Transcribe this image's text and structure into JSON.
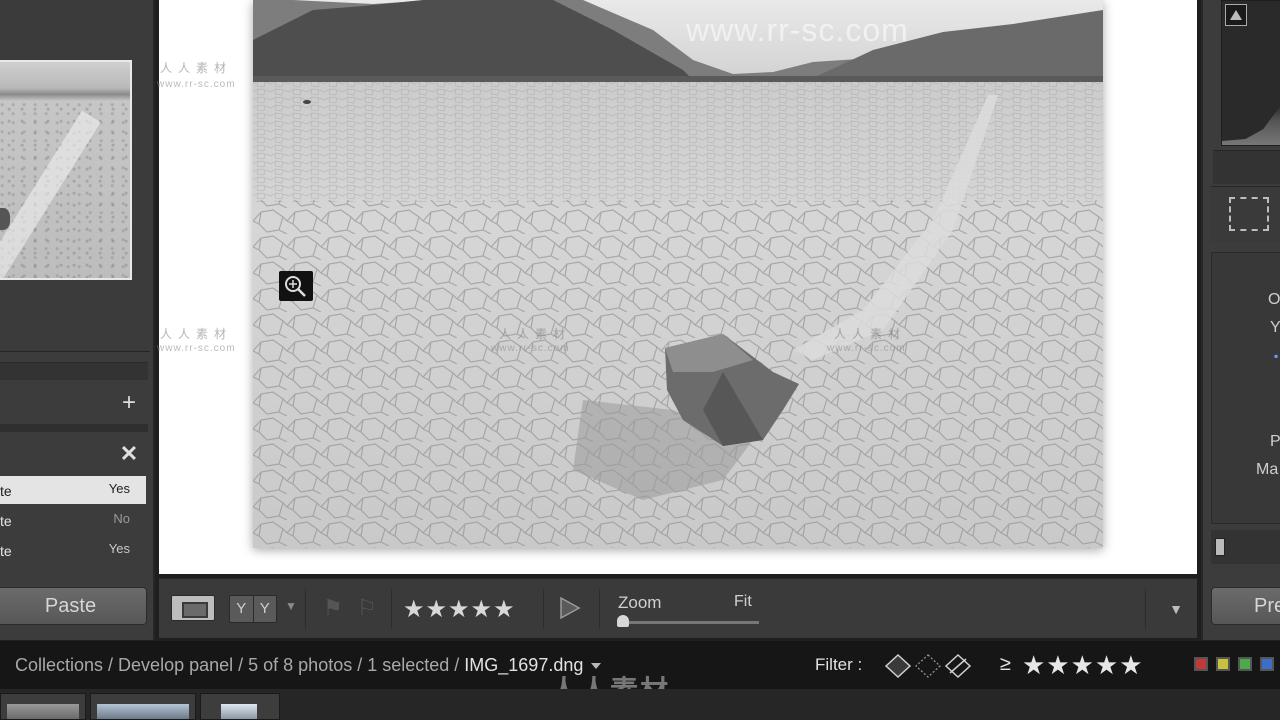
{
  "watermark": {
    "top_url": "www.rr-sc.com",
    "cn": "人人素材",
    "url": "www.rr-sc.com",
    "logo": "人人素材"
  },
  "left_panel": {
    "sync_rows": [
      {
        "key": "te",
        "value": "Yes",
        "selected": true
      },
      {
        "key": "te",
        "value": "No",
        "selected": false
      },
      {
        "key": "te",
        "value": "Yes",
        "selected": false
      }
    ],
    "paste_label": "Paste"
  },
  "toolbar": {
    "ref_left": "Y",
    "ref_right": "Y",
    "stars": "★★★★★",
    "zoom_label": "Zoom",
    "zoom_value": "Fit"
  },
  "right_panel": {
    "labels": [
      "O",
      "Y",
      "",
      "P",
      "Ma"
    ],
    "prev_label": "Pre"
  },
  "statusbar": {
    "breadcrumb": "Collections / Develop panel / 5 of 8 photos / 1 selected / ",
    "filename": "IMG_1697.dng",
    "filter_label": "Filter :",
    "filter_prefix": "≥",
    "filter_stars": "★★★★★",
    "color_labels": [
      "#c03a3a",
      "#c8c040",
      "#4caa4c",
      "#3d6fc8"
    ]
  }
}
